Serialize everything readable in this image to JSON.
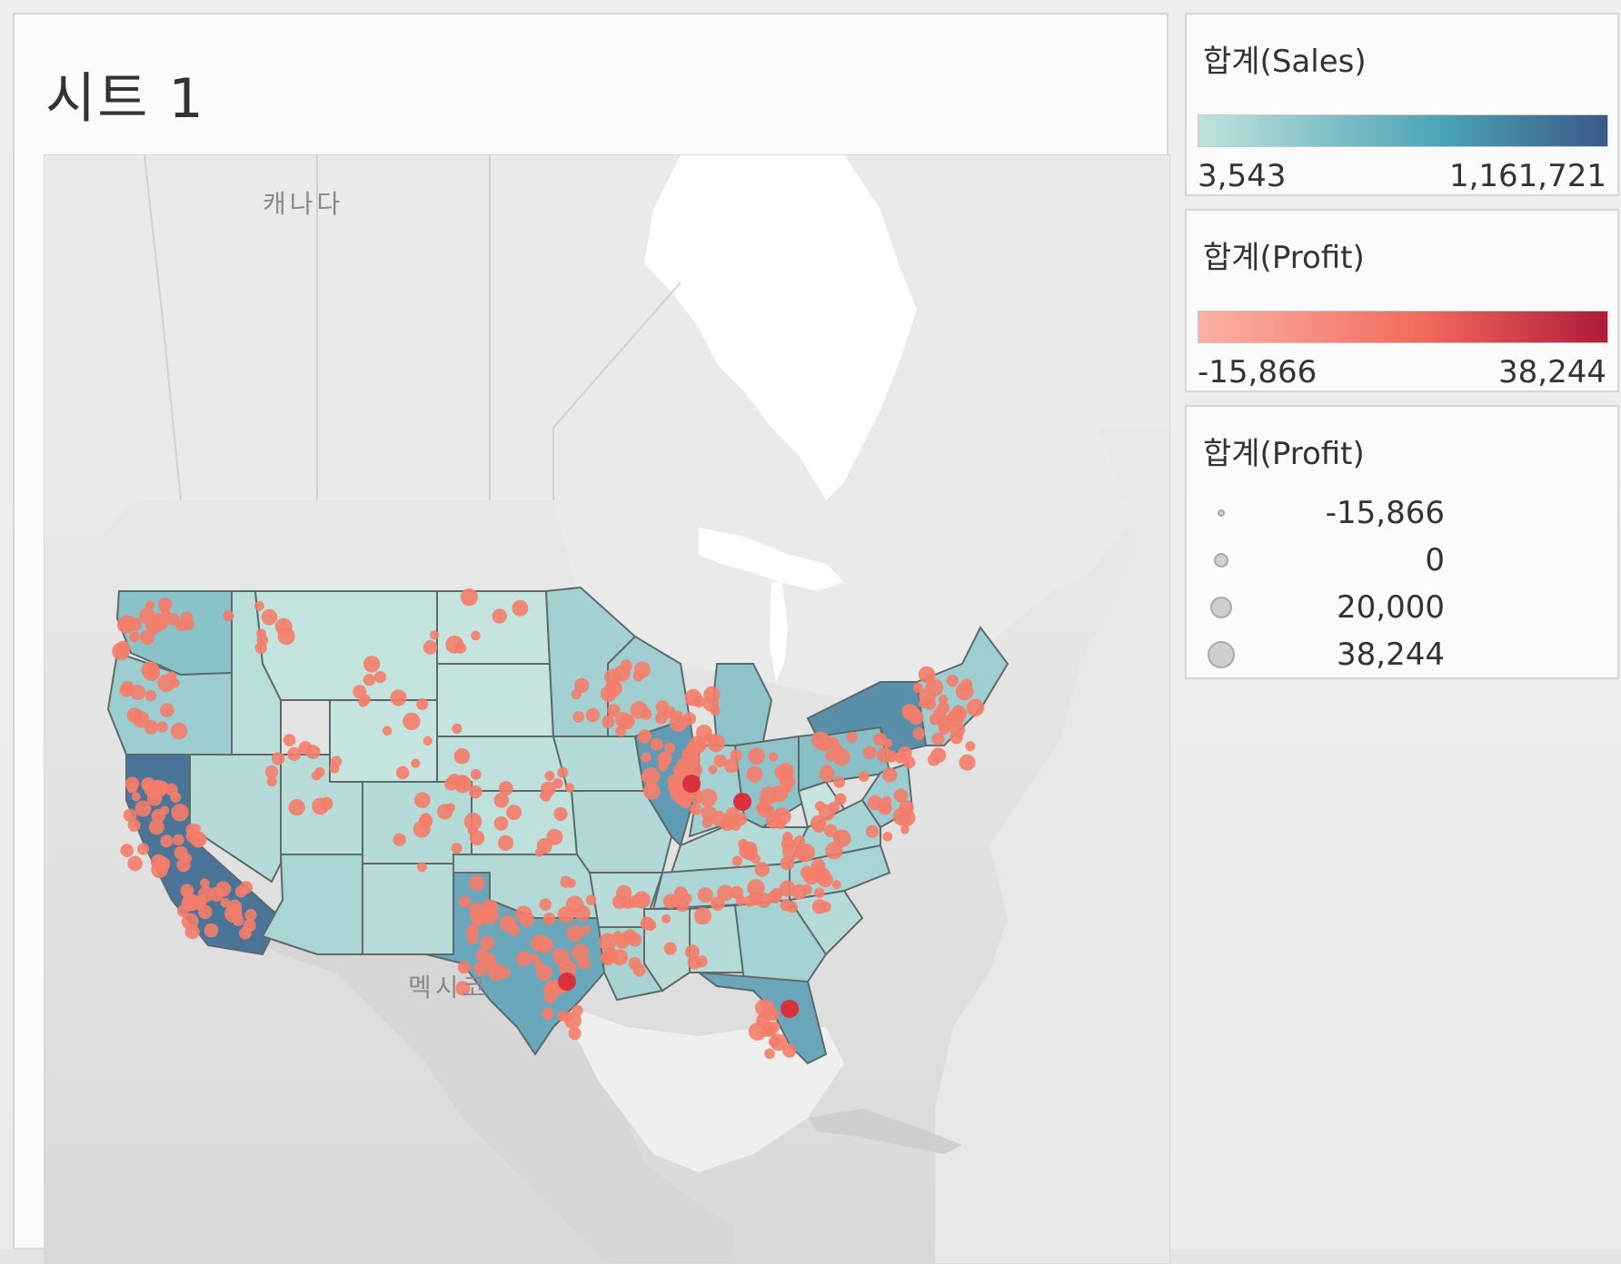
{
  "sheet": {
    "title": "시트 1"
  },
  "map": {
    "labels": {
      "canada": "캐나다",
      "mexico": "멕시코"
    },
    "colors": {
      "background": "#dcdcdc",
      "land": "#e9e9e9",
      "water": "#ffffff",
      "state_fill_low": "#c3e3df",
      "state_fill_high": "#4e7a9b",
      "state_border": "#5f6a6a",
      "point": "#f47d6a"
    }
  },
  "legends": {
    "sales_color": {
      "title": "합계(Sales)",
      "min": "3,543",
      "max": "1,161,721",
      "color_low": "#bfe3dd",
      "color_mid": "#4aa3b7",
      "color_high": "#3a5a86"
    },
    "profit_color": {
      "title": "합계(Profit)",
      "min": "-15,866",
      "max": "38,244",
      "color_low": "#fbb1a4",
      "color_mid": "#f26a5c",
      "color_high": "#b01a3b"
    },
    "profit_size": {
      "title": "합계(Profit)",
      "items": [
        {
          "label": "-15,866"
        },
        {
          "label": "0"
        },
        {
          "label": "20,000"
        },
        {
          "label": "38,244"
        }
      ]
    }
  }
}
